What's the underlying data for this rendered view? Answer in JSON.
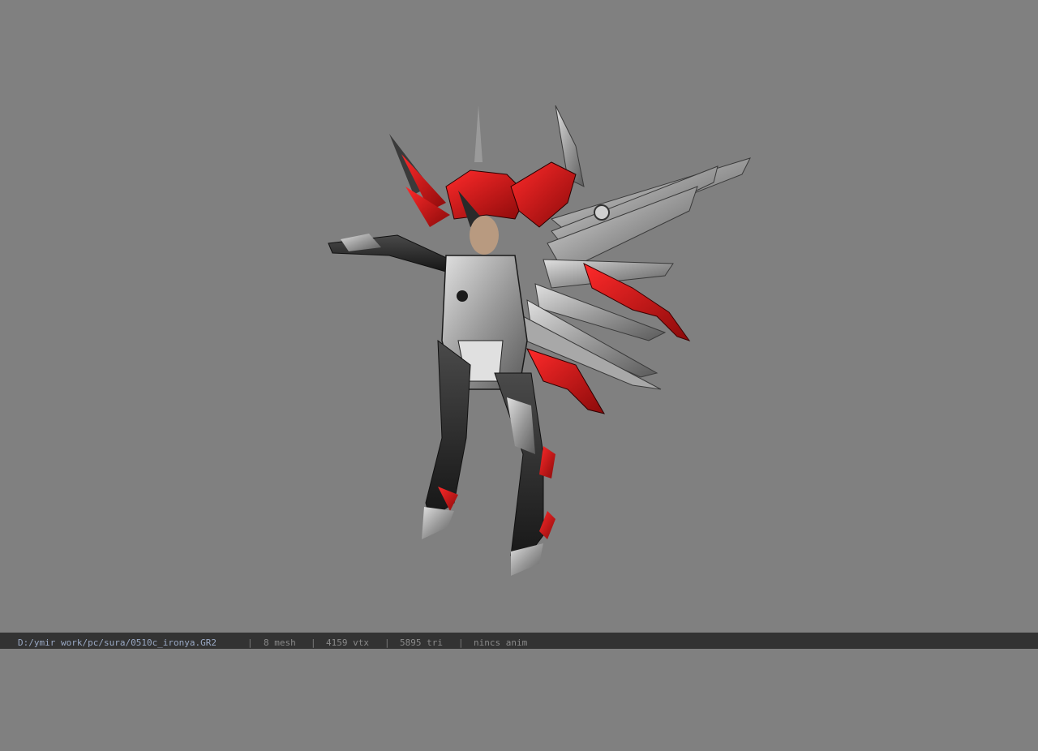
{
  "viewer": {
    "background_color": "#808080",
    "model_name": "armored character with red and silver wings"
  },
  "status": {
    "file_path": "D:/ymir work/pc/sura/0510c_ironya.GR2",
    "separator": "|",
    "mesh": "8 mesh",
    "vertices": "4159 vtx",
    "triangles": "5895 tri",
    "animation": "nincs anim"
  },
  "colors": {
    "statusbar_bg": "#333333",
    "statusbar_text": "#8a8a8a",
    "path_text": "#9aa9c4",
    "armor_red": "#c4141a",
    "armor_silver": "#b8b8b8",
    "armor_dark": "#2a2a2a"
  }
}
